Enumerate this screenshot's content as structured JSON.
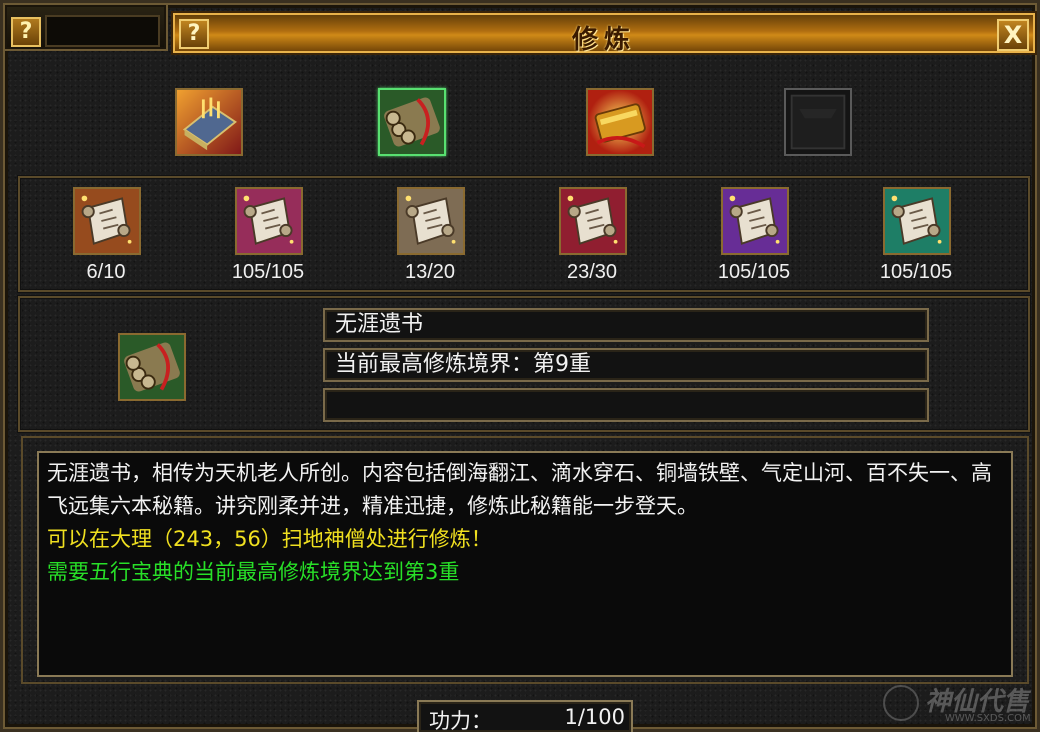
{
  "window": {
    "title": "修炼",
    "help_glyph": "?",
    "close_glyph": "X"
  },
  "books": [
    {
      "name": "book-red-gold",
      "icon": "book-icon",
      "selected": false
    },
    {
      "name": "scroll-bundle-green",
      "icon": "scroll-bundle-icon",
      "selected": true
    },
    {
      "name": "gold-scroll-fire",
      "icon": "gold-scroll-icon",
      "selected": false
    },
    {
      "name": "empty-slot",
      "icon": "empty-slot-icon",
      "selected": false
    }
  ],
  "scrolls": [
    {
      "icon": "scroll-icon",
      "color": "#c86428",
      "count": "6/10"
    },
    {
      "icon": "scroll-icon",
      "color": "#c83c78",
      "count": "105/105"
    },
    {
      "icon": "scroll-icon",
      "color": "#a89070",
      "count": "13/20"
    },
    {
      "icon": "scroll-icon",
      "color": "#c02840",
      "count": "23/30"
    },
    {
      "icon": "scroll-icon",
      "color": "#8a3cc8",
      "count": "105/105"
    },
    {
      "icon": "scroll-icon",
      "color": "#28a888",
      "count": "105/105"
    }
  ],
  "detail": {
    "name": "无涯遗书",
    "realm": "当前最高修炼境界：第9重",
    "extra": ""
  },
  "description": {
    "text": "无涯遗书，相传为天机老人所创。内容包括倒海翻江、滴水穿石、铜墙铁壁、气定山河、百不失一、高飞远集六本秘籍。讲究刚柔并进，精准迅捷，修炼此秘籍能一步登天。",
    "location_hint": "可以在大理（243，56）扫地神僧处进行修炼！",
    "requirement": "需要五行宝典的当前最高修炼境界达到第3重"
  },
  "power": {
    "label": "功力：",
    "value": "1/100"
  },
  "watermark": {
    "brand": "神仙代售",
    "url": "WWW.SXDS.COM"
  },
  "colors": {
    "title_gold": "#d08a18",
    "hint_yellow": "#f0e020",
    "requirement_green": "#28e028",
    "selected_border": "#58e070"
  }
}
